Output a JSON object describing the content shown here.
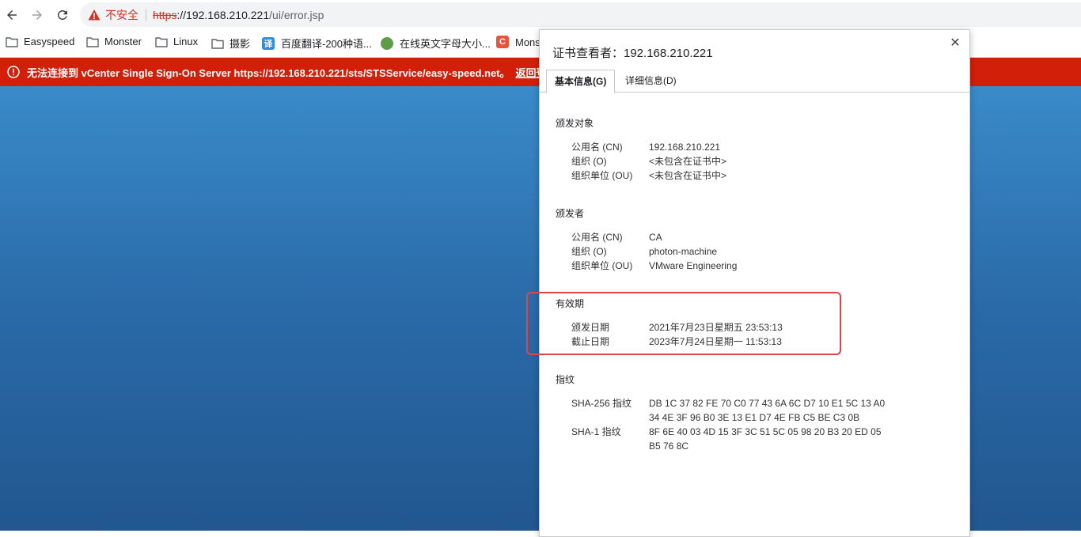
{
  "browser": {
    "security_label": "不安全",
    "url_scheme": "https",
    "url_host": "://192.168.210.221",
    "url_path": "/ui/error.jsp"
  },
  "bookmarks": [
    {
      "label": "Easyspeed",
      "icon": "folder-icon"
    },
    {
      "label": "Monster",
      "icon": "folder-icon"
    },
    {
      "label": "Linux",
      "icon": "folder-icon"
    },
    {
      "label": "摄影",
      "icon": "folder-icon"
    },
    {
      "label": "百度翻译-200种语...",
      "icon": "translate-favicon",
      "badge": "译"
    },
    {
      "label": "在线英文字母大小...",
      "icon": "frog-favicon"
    },
    {
      "label": "Mons",
      "icon": "c-favicon",
      "badge": "C"
    }
  ],
  "banner": {
    "message": "无法连接到 vCenter Single Sign-On Server https://192.168.210.221/sts/STSService/easy-speed.net。",
    "link": "返回登录"
  },
  "dialog": {
    "title": "证书查看者：192.168.210.221",
    "close": "✕",
    "tabs": [
      "基本信息(G)",
      "详细信息(D)"
    ],
    "issued_to": {
      "title": "颁发对象",
      "rows": [
        {
          "k": "公用名 (CN)",
          "v": "192.168.210.221"
        },
        {
          "k": "组织 (O)",
          "v": "<未包含在证书中>"
        },
        {
          "k": "组织单位 (OU)",
          "v": "<未包含在证书中>"
        }
      ]
    },
    "issued_by": {
      "title": "颁发者",
      "rows": [
        {
          "k": "公用名 (CN)",
          "v": "CA"
        },
        {
          "k": "组织 (O)",
          "v": "photon-machine"
        },
        {
          "k": "组织单位 (OU)",
          "v": "VMware Engineering"
        }
      ]
    },
    "validity": {
      "title": "有效期",
      "rows": [
        {
          "k": "颁发日期",
          "v": "2021年7月23日星期五 23:53:13"
        },
        {
          "k": "截止日期",
          "v": "2023年7月24日星期一 11:53:13"
        }
      ]
    },
    "fingerprints": {
      "title": "指纹",
      "rows": [
        {
          "k": "SHA-256 指纹",
          "v": "DB 1C 37 82 FE 70 C0 77 43 6A 6C D7 10 E1 5C 13 A0 34 4E 3F 96 B0 3E 13 E1 D7 4E FB C5 BE C3 0B"
        },
        {
          "k": "SHA-1 指纹",
          "v": "8F 6E 40 03 4D 15 3F 3C 51 5C 05 98 20 B3 20 ED 05 B5 76 8C"
        }
      ]
    }
  },
  "colors": {
    "error_red": "#d21f0a",
    "insecure_red": "#d93025",
    "highlight": "#e0454a"
  }
}
